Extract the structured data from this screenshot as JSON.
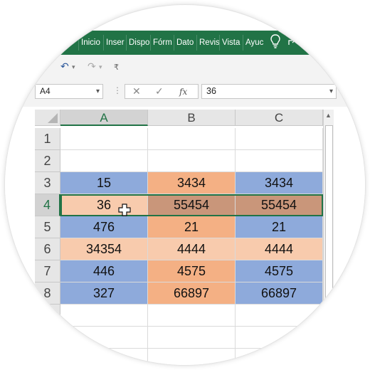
{
  "ribbon": {
    "tabs": [
      "Inicio",
      "Inser",
      "Dispo",
      "Fórm",
      "Dato",
      "Revis",
      "Vista",
      "Ayuc"
    ],
    "bulb_icon": "lightbulb-icon",
    "share_icon": "share-icon",
    "color": "#217346"
  },
  "qat": {
    "undo_icon": "↶",
    "undo_dd": "▾",
    "redo_icon": "↷",
    "redo_dd": "▾",
    "customize": "₹"
  },
  "formula_bar": {
    "name_box": "A4",
    "cancel_icon": "✕",
    "enter_icon": "✓",
    "fx_label": "fx",
    "value": "36"
  },
  "sheet": {
    "columns": [
      "A",
      "B",
      "C"
    ],
    "rows": [
      {
        "num": "1",
        "cells": [
          "",
          "",
          ""
        ]
      },
      {
        "num": "2",
        "cells": [
          "",
          "",
          ""
        ]
      },
      {
        "num": "3",
        "cells": [
          "15",
          "3434",
          "3434"
        ]
      },
      {
        "num": "4",
        "cells": [
          "36",
          "55454",
          "55454"
        ]
      },
      {
        "num": "5",
        "cells": [
          "476",
          "21",
          "21"
        ]
      },
      {
        "num": "6",
        "cells": [
          "34354",
          "4444",
          "4444"
        ]
      },
      {
        "num": "7",
        "cells": [
          "446",
          "4575",
          "4575"
        ]
      },
      {
        "num": "8",
        "cells": [
          "327",
          "66897",
          "66897"
        ]
      },
      {
        "num": "",
        "cells": [
          "",
          "",
          ""
        ]
      }
    ],
    "selected_cell": "A4",
    "colors": {
      "blue": "#8eaadb",
      "orange": "#f4b084",
      "peach": "#f8cbad",
      "brown": "#c9967a"
    }
  }
}
